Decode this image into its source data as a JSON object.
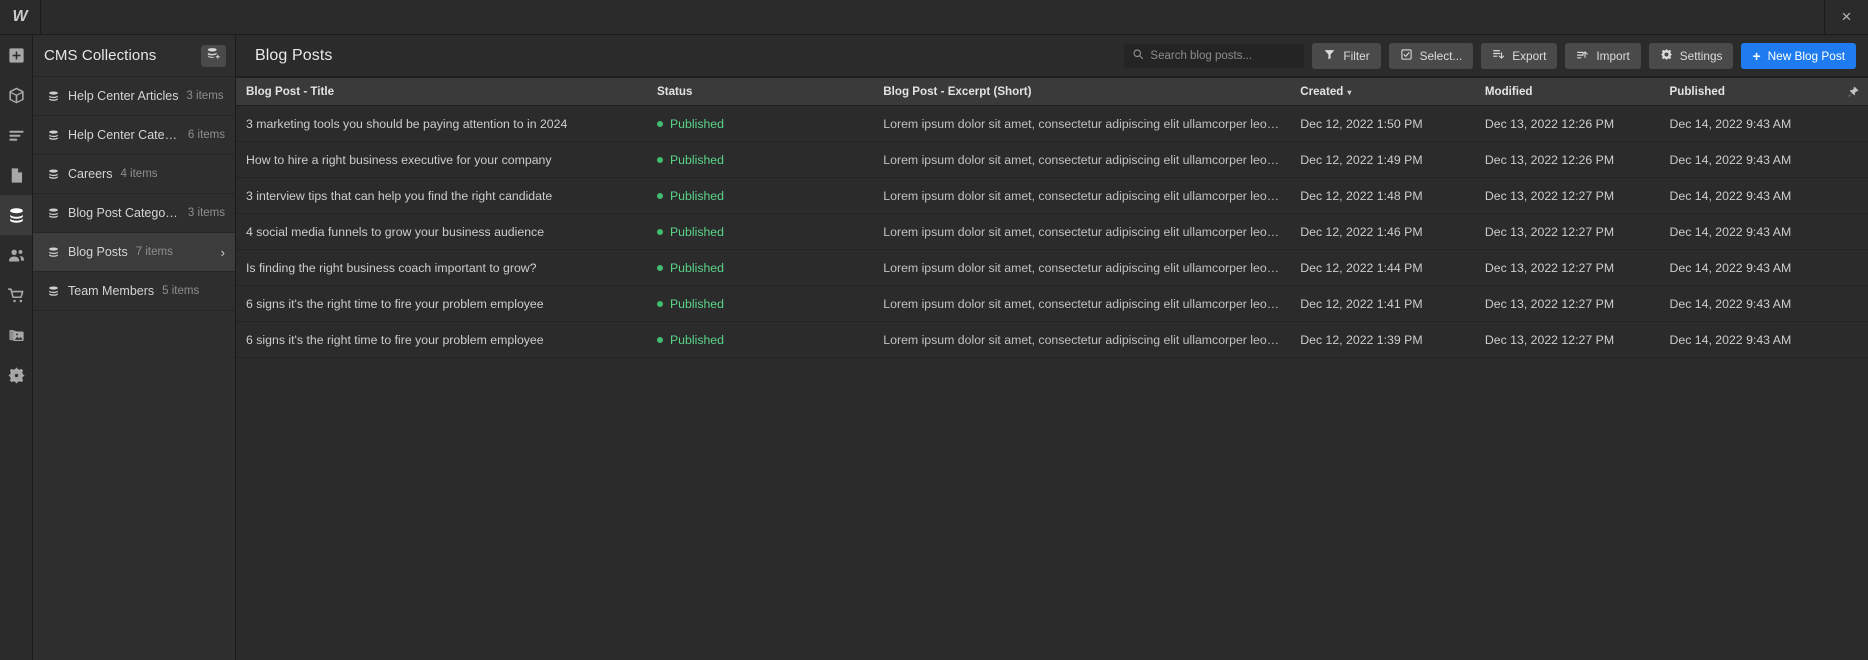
{
  "titlebar": {
    "logo": "W",
    "close_label": "×"
  },
  "rail": {
    "items": [
      {
        "name": "add-panel",
        "icon": "plus-square-icon"
      },
      {
        "name": "components",
        "icon": "cube-icon"
      },
      {
        "name": "navigator",
        "icon": "layers-lines-icon"
      },
      {
        "name": "pages",
        "icon": "page-icon"
      },
      {
        "name": "cms",
        "icon": "database-icon",
        "active": true
      },
      {
        "name": "users",
        "icon": "users-icon"
      },
      {
        "name": "ecommerce",
        "icon": "cart-icon"
      },
      {
        "name": "assets",
        "icon": "images-icon"
      },
      {
        "name": "settings",
        "icon": "gear-icon"
      }
    ]
  },
  "collections": {
    "title": "CMS Collections",
    "add_button_icon": "database-plus-icon",
    "items": [
      {
        "name": "Help Center Articles",
        "count": "3 items",
        "active": false
      },
      {
        "name": "Help Center Categor...",
        "count": "6 items",
        "active": false
      },
      {
        "name": "Careers",
        "count": "4 items",
        "active": false
      },
      {
        "name": "Blog Post Categories",
        "count": "3 items",
        "active": false
      },
      {
        "name": "Blog Posts",
        "count": "7 items",
        "active": true,
        "chevron": "›"
      },
      {
        "name": "Team Members",
        "count": "5 items",
        "active": false
      }
    ]
  },
  "toolbar": {
    "page_title": "Blog Posts",
    "search_placeholder": "Search blog posts...",
    "filter_label": "Filter",
    "select_label": "Select...",
    "export_label": "Export",
    "import_label": "Import",
    "settings_label": "Settings",
    "new_label": "New Blog Post",
    "new_plus": "+",
    "accent_color": "#1e7cf0"
  },
  "table": {
    "columns": [
      {
        "label": "Blog Post - Title",
        "sorted": false
      },
      {
        "label": "Status",
        "sorted": false
      },
      {
        "label": "Blog Post - Excerpt (Short)",
        "sorted": false
      },
      {
        "label": "Created",
        "sorted": true,
        "caret": "▾"
      },
      {
        "label": "Modified",
        "sorted": false
      },
      {
        "label": "Published",
        "sorted": false,
        "pin_icon": "pin-icon"
      }
    ],
    "status_color": "#5bd48a",
    "rows": [
      {
        "title": "3 marketing tools you should be paying attention to in 2024",
        "status": "Published",
        "excerpt": "Lorem ipsum dolor sit amet, consectetur adipiscing elit ullamcorper leo vi...",
        "created": "Dec 12, 2022 1:50 PM",
        "modified": "Dec 13, 2022 12:26 PM",
        "published": "Dec 14, 2022 9:43 AM"
      },
      {
        "title": "How to hire a right business executive for your company",
        "status": "Published",
        "excerpt": "Lorem ipsum dolor sit amet, consectetur adipiscing elit ullamcorper leo vi...",
        "created": "Dec 12, 2022 1:49 PM",
        "modified": "Dec 13, 2022 12:26 PM",
        "published": "Dec 14, 2022 9:43 AM"
      },
      {
        "title": "3 interview tips that can help you find the right candidate",
        "status": "Published",
        "excerpt": "Lorem ipsum dolor sit amet, consectetur adipiscing elit ullamcorper leo vi...",
        "created": "Dec 12, 2022 1:48 PM",
        "modified": "Dec 13, 2022 12:27 PM",
        "published": "Dec 14, 2022 9:43 AM"
      },
      {
        "title": "4 social media funnels to grow your business audience",
        "status": "Published",
        "excerpt": "Lorem ipsum dolor sit amet, consectetur adipiscing elit ullamcorper leo vi...",
        "created": "Dec 12, 2022 1:46 PM",
        "modified": "Dec 13, 2022 12:27 PM",
        "published": "Dec 14, 2022 9:43 AM"
      },
      {
        "title": "Is finding the right business coach important to grow?",
        "status": "Published",
        "excerpt": "Lorem ipsum dolor sit amet, consectetur adipiscing elit ullamcorper leo vi...",
        "created": "Dec 12, 2022 1:44 PM",
        "modified": "Dec 13, 2022 12:27 PM",
        "published": "Dec 14, 2022 9:43 AM"
      },
      {
        "title": "6 signs it's the right time to fire your problem employee",
        "status": "Published",
        "excerpt": "Lorem ipsum dolor sit amet, consectetur adipiscing elit ullamcorper leo vi...",
        "created": "Dec 12, 2022 1:41 PM",
        "modified": "Dec 13, 2022 12:27 PM",
        "published": "Dec 14, 2022 9:43 AM"
      },
      {
        "title": "6 signs it's the right time to fire your problem employee",
        "status": "Published",
        "excerpt": "Lorem ipsum dolor sit amet, consectetur adipiscing elit ullamcorper leo vi...",
        "created": "Dec 12, 2022 1:39 PM",
        "modified": "Dec 13, 2022 12:27 PM",
        "published": "Dec 14, 2022 9:43 AM"
      }
    ]
  }
}
